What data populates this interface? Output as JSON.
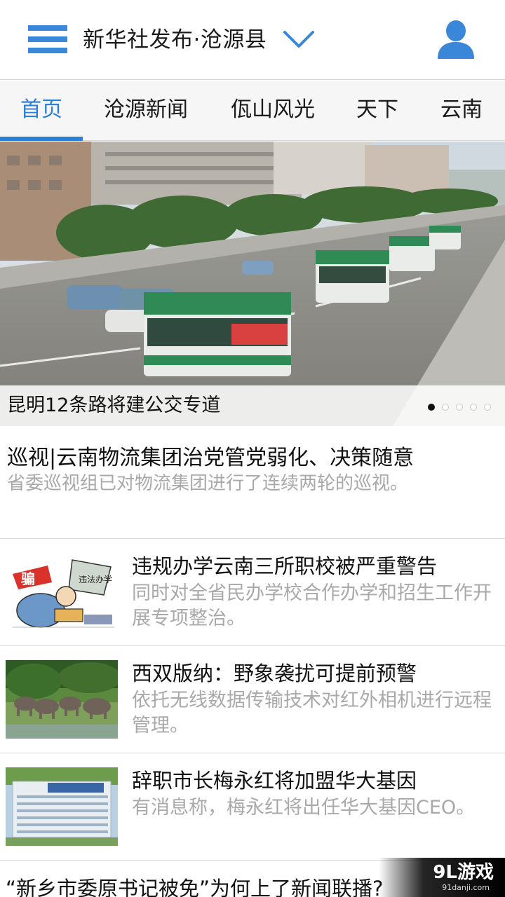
{
  "header": {
    "title": "新华社发布·沧源县",
    "menu_icon": "hamburger-menu-icon",
    "dropdown_icon": "chevron-down-icon",
    "user_icon": "user-profile-icon",
    "accent_color": "#3a86d8"
  },
  "tabs": [
    {
      "label": "首页",
      "active": true
    },
    {
      "label": "沧源新闻",
      "active": false
    },
    {
      "label": "佤山风光",
      "active": false
    },
    {
      "label": "天下",
      "active": false
    },
    {
      "label": "云南",
      "active": false
    }
  ],
  "banner": {
    "caption": "昆明12条路将建公交专道",
    "slide_count": 5,
    "active_slide": 1
  },
  "feature": {
    "title": "巡视|云南物流集团治党管党弱化、决策随意",
    "summary": "省委巡视组已对物流集团进行了连续两轮的巡视。"
  },
  "news": [
    {
      "title": "违规办学云南三所职校被严重警告",
      "summary": "同时对全省民办学校合作办学和招生工作开展专项整治。"
    },
    {
      "title": "西双版纳：野象袭扰可提前预警",
      "summary": "依托无线数据传输技术对红外相机进行远程管理。"
    },
    {
      "title": "辞职市长梅永红将加盟华大基因",
      "summary": "有消息称，梅永红将出任华大基因CEO。"
    }
  ],
  "partial_item": {
    "title": "“新乡市委原书记被免”为何上了新闻联播?"
  },
  "watermark": {
    "logo": "9L游戏",
    "domain": "91danji.com"
  },
  "colors": {
    "active_tab": "#2a7fd6",
    "summary_text": "#a9a9a9"
  }
}
